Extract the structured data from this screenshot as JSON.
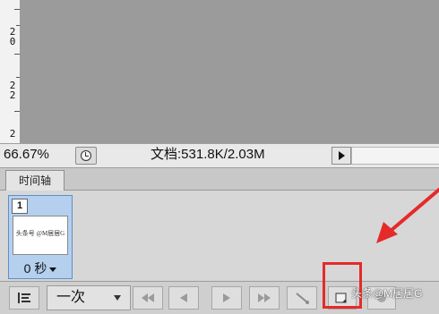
{
  "ruler": {
    "labels": [
      {
        "digits": [
          "2",
          "0"
        ]
      },
      {
        "digits": [
          "2",
          "2"
        ]
      },
      {
        "digits": [
          "2"
        ]
      }
    ]
  },
  "status_bar": {
    "zoom": "66.67%",
    "doc_info": "文档:531.8K/2.03M"
  },
  "timeline_panel": {
    "tab_label": "时间轴",
    "frame": {
      "number": "1",
      "thumbnail_text": "头条号 @M居居G",
      "delay": "0 秒"
    }
  },
  "toolbar": {
    "loop_value": "一次",
    "icons": [
      "convert-to-video-icon",
      "loop-dropdown-caret-icon",
      "first-frame-icon",
      "previous-frame-icon",
      "play-icon",
      "next-frame-icon",
      "tween-icon",
      "duplicate-frame-icon",
      "delete-frame-icon"
    ]
  },
  "watermark": "头条@M居居G",
  "colors": {
    "annotation_red": "#e52a2a",
    "frame_selected": "#b4d0ee",
    "canvas_grey": "#9b9b9b"
  }
}
